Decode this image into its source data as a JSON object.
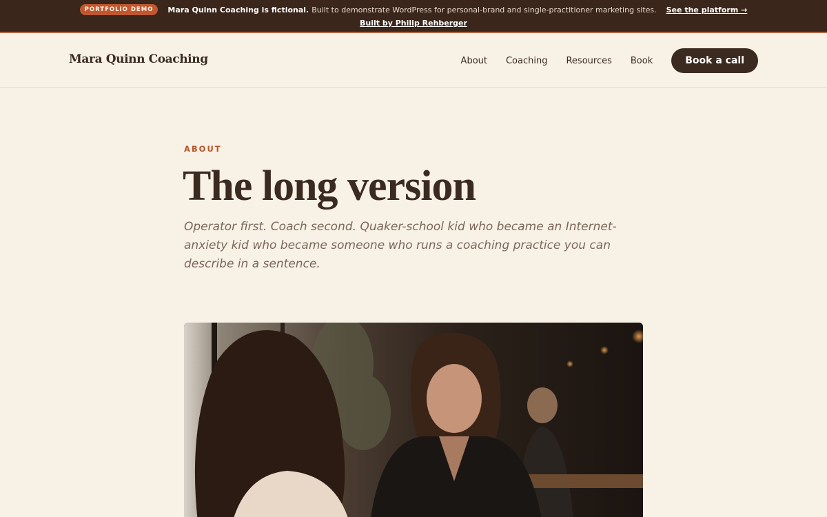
{
  "banner": {
    "pill": "PORTFOLIO DEMO",
    "strong": "Mara Quinn Coaching is fictional.",
    "text": "Built to demonstrate WordPress for personal-brand and single-practitioner marketing sites.",
    "link": "See the platform →",
    "credit": "Built by Philip Rehberger"
  },
  "header": {
    "brand": "Mara Quinn Coaching",
    "nav": [
      "About",
      "Coaching",
      "Resources",
      "Book"
    ],
    "cta": "Book a call"
  },
  "hero": {
    "eyebrow": "ABOUT",
    "title": "The long version",
    "lead": "Operator first. Coach second. Quaker-school kid who became an Internet-anxiety kid who became someone who runs a coaching practice you can describe in a sentence."
  },
  "colors": {
    "background": "#f8f1e6",
    "banner": "#3a261b",
    "accent": "#b8562c",
    "text": "#3b2a20"
  }
}
